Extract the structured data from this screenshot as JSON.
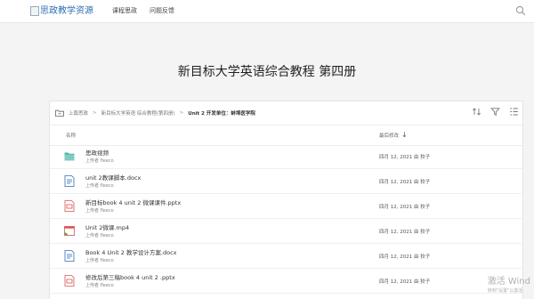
{
  "header": {
    "logo_text": "思政教学资源",
    "nav": [
      "课程思政",
      "问题反馈"
    ],
    "search_icon": "search-icon"
  },
  "page_title": "新目标大学英语综合教程 第四册",
  "library": {
    "breadcrumb": [
      "上篇思政",
      "新目标大学英语 综合教程(第四册)",
      "Unit 2 开发单位：蚌埠医学院"
    ],
    "toolbar_icons": [
      "sort-icon",
      "filter-icon",
      "view-options-icon"
    ],
    "columns": {
      "name": "名称",
      "modified": "最后修改"
    },
    "files": [
      {
        "name": "思政视频",
        "uploaded_by": "上传者 fleeco",
        "date": "四月 12, 2021 由 狡子",
        "type": "folder"
      },
      {
        "name": "unit 2教课脚本.docx",
        "uploaded_by": "上传者 fleeco",
        "date": "四月 12, 2021 由 狡子",
        "type": "docx"
      },
      {
        "name": "新目标book 4 unit 2 微课课件.pptx",
        "uploaded_by": "上传者 fleeco",
        "date": "四月 12, 2021 由 狡子",
        "type": "pptx"
      },
      {
        "name": "Unit 2微课.mp4",
        "uploaded_by": "上传者 fleeco",
        "date": "四月 12, 2021 由 狡子",
        "type": "video"
      },
      {
        "name": "Book 4 Unit 2 教学设计方案.docx",
        "uploaded_by": "上传者 fleeco",
        "date": "四月 12, 2021 由 狡子",
        "type": "docx"
      },
      {
        "name": "修改后第三稿book 4 unit 2 .pptx",
        "uploaded_by": "上传者 fleeco",
        "date": "四月 12, 2021 由 狡子",
        "type": "pptx"
      }
    ]
  },
  "watermark": {
    "line1": "激活 Wind",
    "line2": "转到\"设置\"以激活"
  },
  "colors": {
    "folder": "#4db6ac",
    "docx": "#2f6fb3",
    "pptx": "#d9534f",
    "video": "#d9534f",
    "logo": "#2f6fb3"
  }
}
